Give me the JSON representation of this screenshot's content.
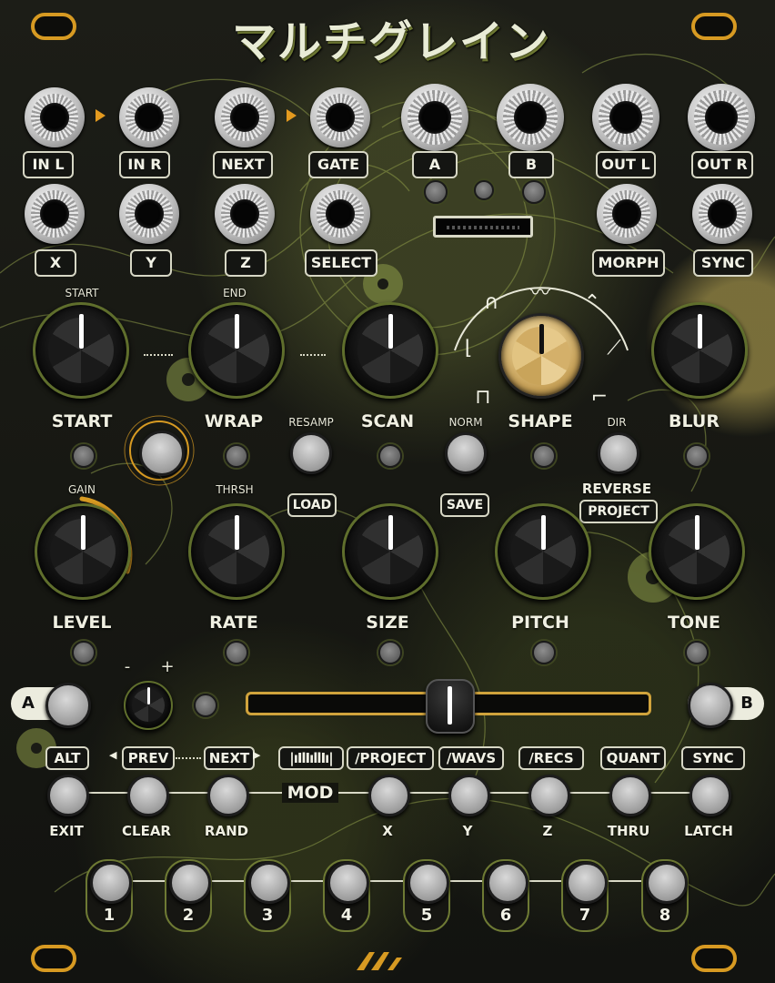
{
  "title": "マルチグレイン",
  "jacks_row1": [
    {
      "label": "IN L"
    },
    {
      "label": "IN R"
    },
    {
      "label": "NEXT"
    },
    {
      "label": "GATE"
    },
    {
      "label": "A"
    },
    {
      "label": "B"
    },
    {
      "label": "OUT L"
    },
    {
      "label": "OUT R"
    }
  ],
  "jacks_row2": [
    {
      "label": "X"
    },
    {
      "label": "Y"
    },
    {
      "label": "Z"
    },
    {
      "label": "SELECT"
    },
    {
      "label": "MORPH"
    },
    {
      "label": "SYNC"
    }
  ],
  "knobs_row1": [
    {
      "top_label": "START",
      "label": "START",
      "value_deg": 0
    },
    {
      "top_label": "END",
      "label": "WRAP",
      "value_deg": 0
    },
    {
      "top_label": "",
      "label": "SCAN",
      "value_deg": 0
    },
    {
      "top_label": "",
      "label": "SHAPE",
      "value_deg": 0
    },
    {
      "top_label": "",
      "label": "BLUR",
      "value_deg": 0
    }
  ],
  "knobs_row2": [
    {
      "top_label": "GAIN",
      "label": "LEVEL",
      "value_deg": 0
    },
    {
      "top_label": "THRSH",
      "label": "RATE",
      "value_deg": 0
    },
    {
      "top_label": "",
      "label": "SIZE",
      "value_deg": 0
    },
    {
      "top_label": "",
      "label": "PITCH",
      "value_deg": 0
    },
    {
      "top_label": "",
      "label": "TONE",
      "value_deg": 0
    }
  ],
  "mid_buttons": {
    "resamp_label": "RESAMP",
    "load_label": "LOAD",
    "norm_label": "NORM",
    "save_label": "SAVE",
    "dir_label": "DIR",
    "reverse_label": "REVERSE",
    "project_label": "PROJECT"
  },
  "crossfader": {
    "a_label": "A",
    "b_label": "B",
    "position": 0.5,
    "minus": "-",
    "plus": "+"
  },
  "function_row": [
    {
      "top": "ALT",
      "bottom": "EXIT"
    },
    {
      "top": "PREV",
      "bottom": "CLEAR"
    },
    {
      "top": "NEXT",
      "bottom": "RAND"
    },
    {
      "top": "/PROJECT",
      "bottom": "X"
    },
    {
      "top": "/WAVS",
      "bottom": "Y"
    },
    {
      "top": "/RECS",
      "bottom": "Z"
    },
    {
      "top": "QUANT",
      "bottom": "THRU"
    },
    {
      "top": "SYNC",
      "bottom": "LATCH"
    }
  ],
  "mod_label": "MOD",
  "step_buttons": [
    "1",
    "2",
    "3",
    "4",
    "5",
    "6",
    "7",
    "8"
  ],
  "colors": {
    "accent": "#d79a22",
    "olive": "#6e7a34",
    "panel": "#161712",
    "text": "#f0f0e2"
  },
  "icons": {
    "waveform": "waveform-icon",
    "logo": "brand-logo"
  }
}
